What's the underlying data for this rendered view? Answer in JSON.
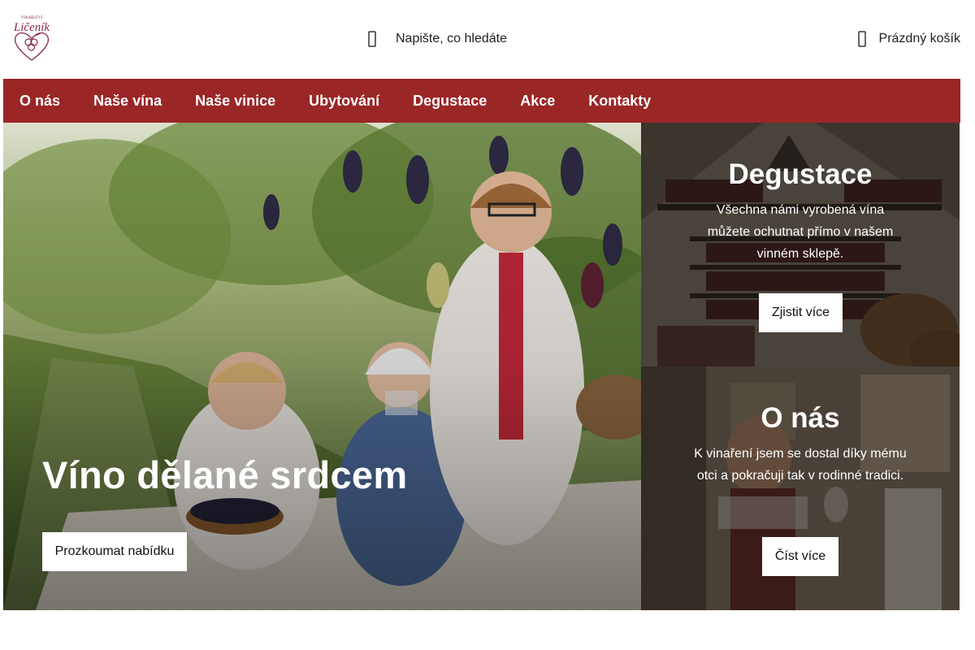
{
  "header": {
    "logo_text_top": "VINAŘSTVÍ",
    "logo_text_main": "Ličeník",
    "search_placeholder": "Napište, co hledáte",
    "cart_label": "Prázdný košík"
  },
  "nav": {
    "items": [
      "O nás",
      "Naše vína",
      "Naše vinice",
      "Ubytování",
      "Degustace",
      "Akce",
      "Kontakty"
    ]
  },
  "hero": {
    "title": "Víno dělané srdcem",
    "button": "Prozkoumat nabídku"
  },
  "panels": {
    "tasting": {
      "title": "Degustace",
      "text": "Všechna námi vyrobená vína můžete ochutnat přímo v našem vinném sklepě.",
      "button": "Zjistit více"
    },
    "about": {
      "title": "O nás",
      "text": "K vinaření jsem se dostal díky mému otci a pokračuji tak v rodinné tradici.",
      "button": "Číst více"
    }
  },
  "colors": {
    "nav_background": "#9b2626",
    "logo_color": "#8a2a4a",
    "button_background": "#ffffff"
  },
  "icons": {
    "search": "search-icon",
    "cart": "shopping-bag-icon"
  }
}
